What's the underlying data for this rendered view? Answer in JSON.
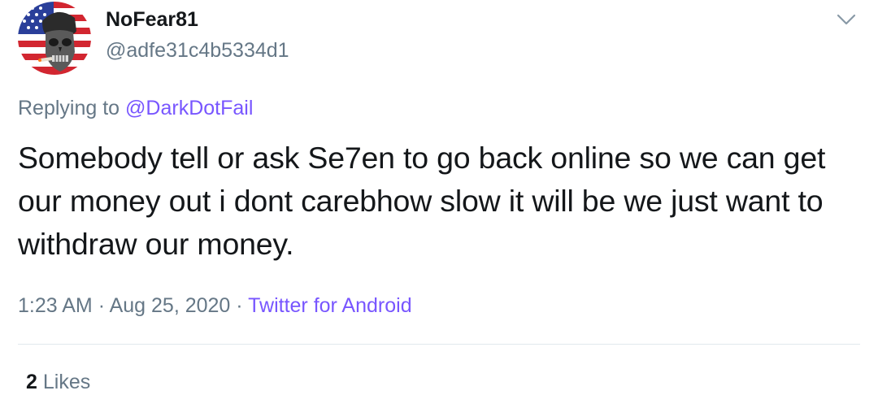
{
  "author": {
    "display_name": "NoFear81",
    "handle": "@adfe31c4b5334d1"
  },
  "reply": {
    "prefix": "Replying to",
    "mention": "@DarkDotFail"
  },
  "tweet": {
    "text": "Somebody tell or ask Se7en to go back online so we can get our money out i dont carebhow slow it will be we just want to withdraw our money."
  },
  "meta": {
    "time": "1:23 AM",
    "separator": "·",
    "date": "Aug 25, 2020",
    "source": "Twitter for Android"
  },
  "stats": {
    "likes_count": "2",
    "likes_label": "Likes"
  },
  "icons": {
    "menu": "chevron-down-icon",
    "avatar": "flag-skull-avatar"
  },
  "colors": {
    "link": "#7856ff",
    "secondary_text": "#657786",
    "primary_text": "#14171a",
    "divider": "#e1e8ed"
  }
}
